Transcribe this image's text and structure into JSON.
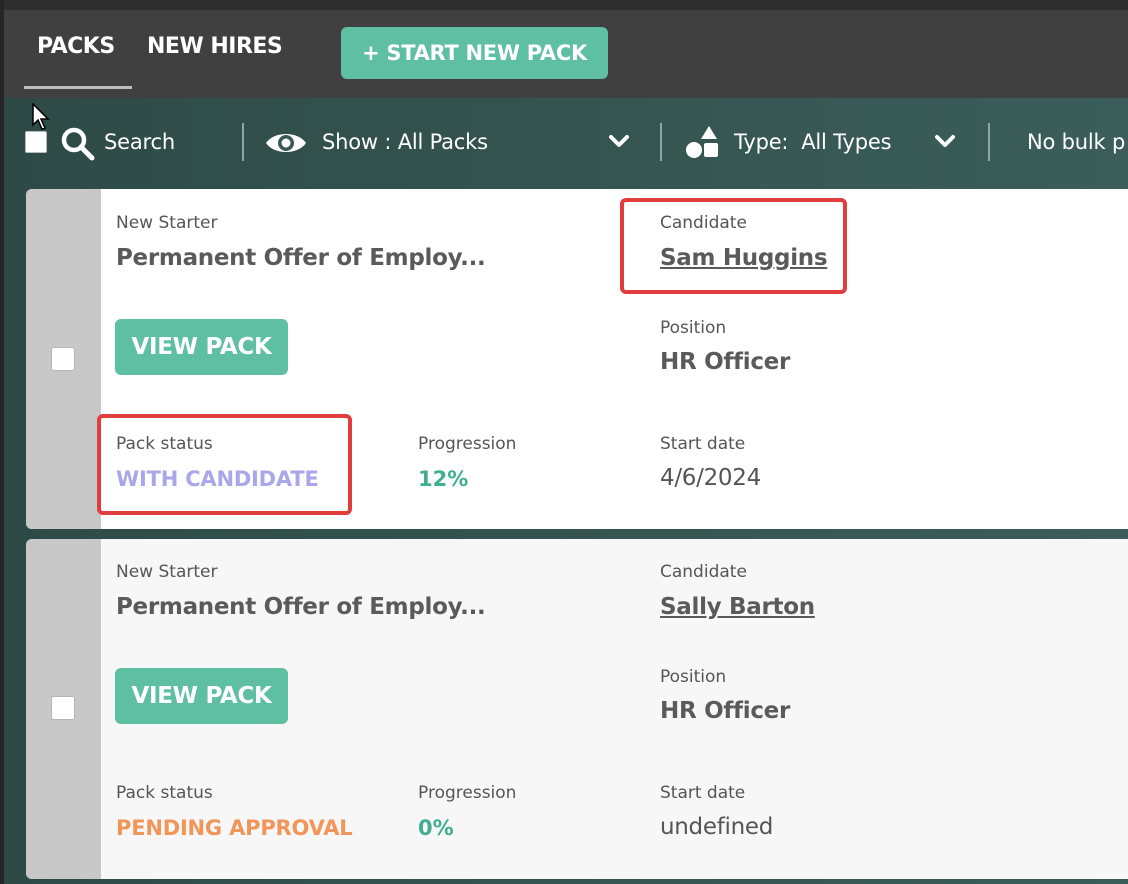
{
  "tabs": [
    {
      "label": "PACKS",
      "active": true
    },
    {
      "label": "NEW HIRES",
      "active": false
    }
  ],
  "start_button": "+ START NEW PACK",
  "filters": {
    "search_label": "Search",
    "show_label": "Show : All Packs",
    "type_label": "Type:  All Types",
    "bulk_label": "No bulk p"
  },
  "cards": [
    {
      "new_starter_label": "New Starter",
      "new_starter_value": "Permanent Offer of Employ...",
      "candidate_label": "Candidate",
      "candidate_value": "Sam Huggins",
      "view_button": "VIEW PACK",
      "position_label": "Position",
      "position_value": "HR Officer",
      "status_label": "Pack status",
      "status_value": "WITH CANDIDATE",
      "status_color": "#a9a6ea",
      "progression_label": "Progression",
      "progression_value": "12%",
      "start_date_label": "Start date",
      "start_date_value": "4/6/2024"
    },
    {
      "new_starter_label": "New Starter",
      "new_starter_value": "Permanent Offer of Employ...",
      "candidate_label": "Candidate",
      "candidate_value": "Sally Barton",
      "view_button": "VIEW PACK",
      "position_label": "Position",
      "position_value": "HR Officer",
      "status_label": "Pack status",
      "status_value": "PENDING APPROVAL",
      "status_color": "#f2955a",
      "progression_label": "Progression",
      "progression_value": "0%",
      "start_date_label": "Start date",
      "start_date_value": "undefined"
    }
  ],
  "colors": {
    "accent": "#5fbfa2",
    "highlight": "#e23d3d"
  }
}
